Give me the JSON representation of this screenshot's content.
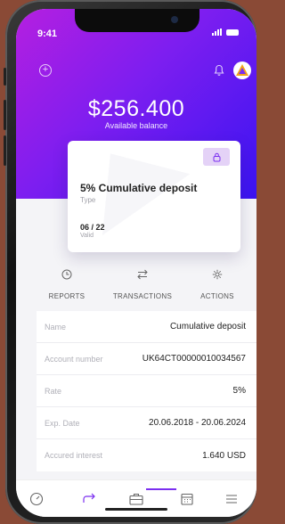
{
  "status_bar": {
    "time": "9:41"
  },
  "balance": {
    "amount": "$256.400",
    "label": "Available balance"
  },
  "card": {
    "title": "5% Cumulative deposit",
    "type_label": "Type",
    "valid_value": "06 / 22",
    "valid_label": "Valid"
  },
  "actions": [
    {
      "label": "REPORTS",
      "icon": "clock-icon"
    },
    {
      "label": "TRANSACTIONS",
      "icon": "swap-arrows-icon"
    },
    {
      "label": "ACTIONS",
      "icon": "gear-icon"
    }
  ],
  "details": [
    {
      "key": "Name",
      "value": "Cumulative deposit"
    },
    {
      "key": "Account number",
      "value": "UK64CT00000010034567"
    },
    {
      "key": "Rate",
      "value": "5%"
    },
    {
      "key": "Exp. Date",
      "value": "20.06.2018 - 20.06.2024"
    },
    {
      "key": "Accured interest",
      "value": "1.640 USD"
    }
  ],
  "tabbar": [
    {
      "icon": "gauge-icon",
      "active": false
    },
    {
      "icon": "transfer-arrow-icon",
      "active": false
    },
    {
      "icon": "briefcase-icon",
      "active": true
    },
    {
      "icon": "calendar-icon",
      "active": false
    },
    {
      "icon": "menu-icon",
      "active": false
    }
  ],
  "colors": {
    "accent": "#7b2ff0",
    "header_start": "#b51fe0",
    "header_end": "#3a14f2"
  }
}
